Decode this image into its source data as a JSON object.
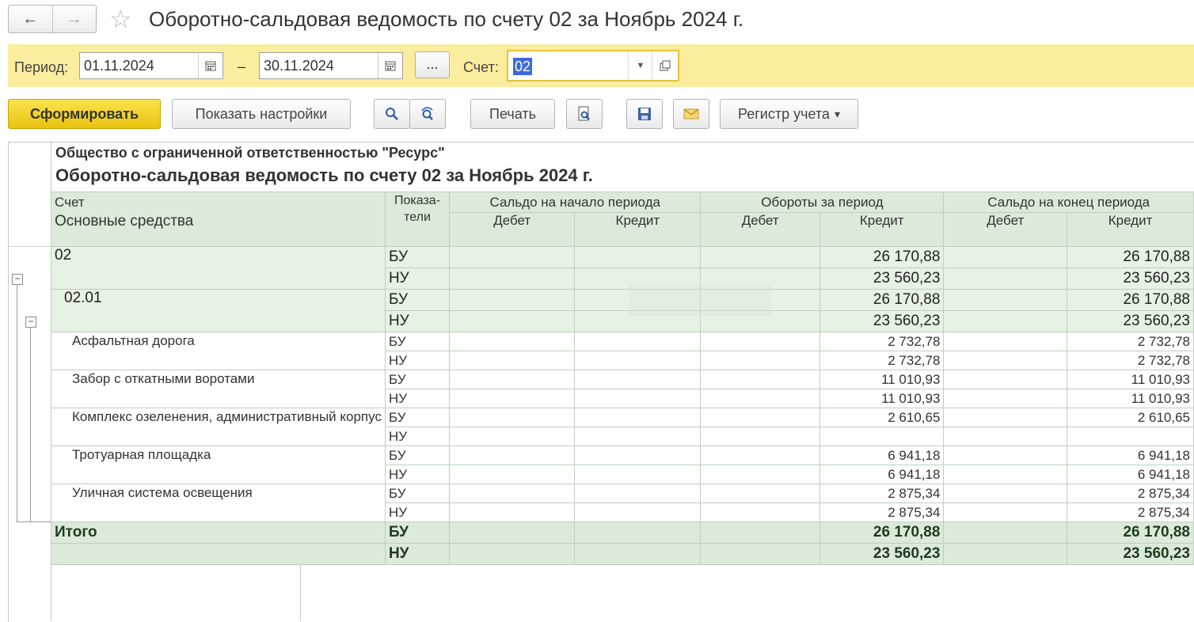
{
  "window": {
    "title": "Оборотно-сальдовая ведомость по счету 02 за Ноябрь 2024 г."
  },
  "nav": {
    "back_icon": "←",
    "forward_icon": "→",
    "star_icon": "☆"
  },
  "params": {
    "period_label": "Период:",
    "date_from": "01.11.2024",
    "dash": "–",
    "date_to": "30.11.2024",
    "ellipsis": "...",
    "account_label": "Счет:",
    "account_value": "02"
  },
  "toolbar": {
    "generate": "Сформировать",
    "show_settings": "Показать настройки",
    "print": "Печать",
    "register": "Регистр учета",
    "register_arrow": "▾"
  },
  "report": {
    "org": "Общество с ограниченной ответственностью \"Ресурс\"",
    "title": "Оборотно-сальдовая ведомость по счету 02 за Ноябрь 2024 г.",
    "headers": {
      "account": "Счет",
      "subconto": "Основные средства",
      "indicators": "Показа-\nтели",
      "opening": "Сальдо на начало периода",
      "turnover": "Обороты за период",
      "closing": "Сальдо на конец периода",
      "debit": "Дебет",
      "credit": "Кредит"
    },
    "rows": [
      {
        "name": "02",
        "kind": "acc",
        "bu": "26 170,88",
        "nu": "23 560,23",
        "bu_end": "26 170,88",
        "nu_end": "23 560,23"
      },
      {
        "name": "02.01",
        "kind": "acc",
        "bu": "26 170,88",
        "nu": "23 560,23",
        "bu_end": "26 170,88",
        "nu_end": "23 560,23"
      },
      {
        "name": "Асфальтная дорога",
        "kind": "sub",
        "bu": "2 732,78",
        "nu": "2 732,78",
        "bu_end": "2 732,78",
        "nu_end": "2 732,78"
      },
      {
        "name": "Забор с откатными воротами",
        "kind": "sub",
        "bu": "11 010,93",
        "nu": "11 010,93",
        "bu_end": "11 010,93",
        "nu_end": "11 010,93"
      },
      {
        "name": "Комплекс озеленения, административный корпус",
        "kind": "sub",
        "bu": "2 610,65",
        "nu": "",
        "bu_end": "2 610,65",
        "nu_end": ""
      },
      {
        "name": "Тротуарная площадка",
        "kind": "sub",
        "bu": "6 941,18",
        "nu": "6 941,18",
        "bu_end": "6 941,18",
        "nu_end": "6 941,18"
      },
      {
        "name": "Уличная система освещения",
        "kind": "sub",
        "bu": "2 875,34",
        "nu": "2 875,34",
        "bu_end": "2 875,34",
        "nu_end": "2 875,34"
      }
    ],
    "total": {
      "name": "Итого",
      "bu": "26 170,88",
      "nu": "23 560,23",
      "bu_end": "26 170,88",
      "nu_end": "23 560,23"
    },
    "bu_label": "БУ",
    "nu_label": "НУ",
    "collapse_icon": "−"
  }
}
